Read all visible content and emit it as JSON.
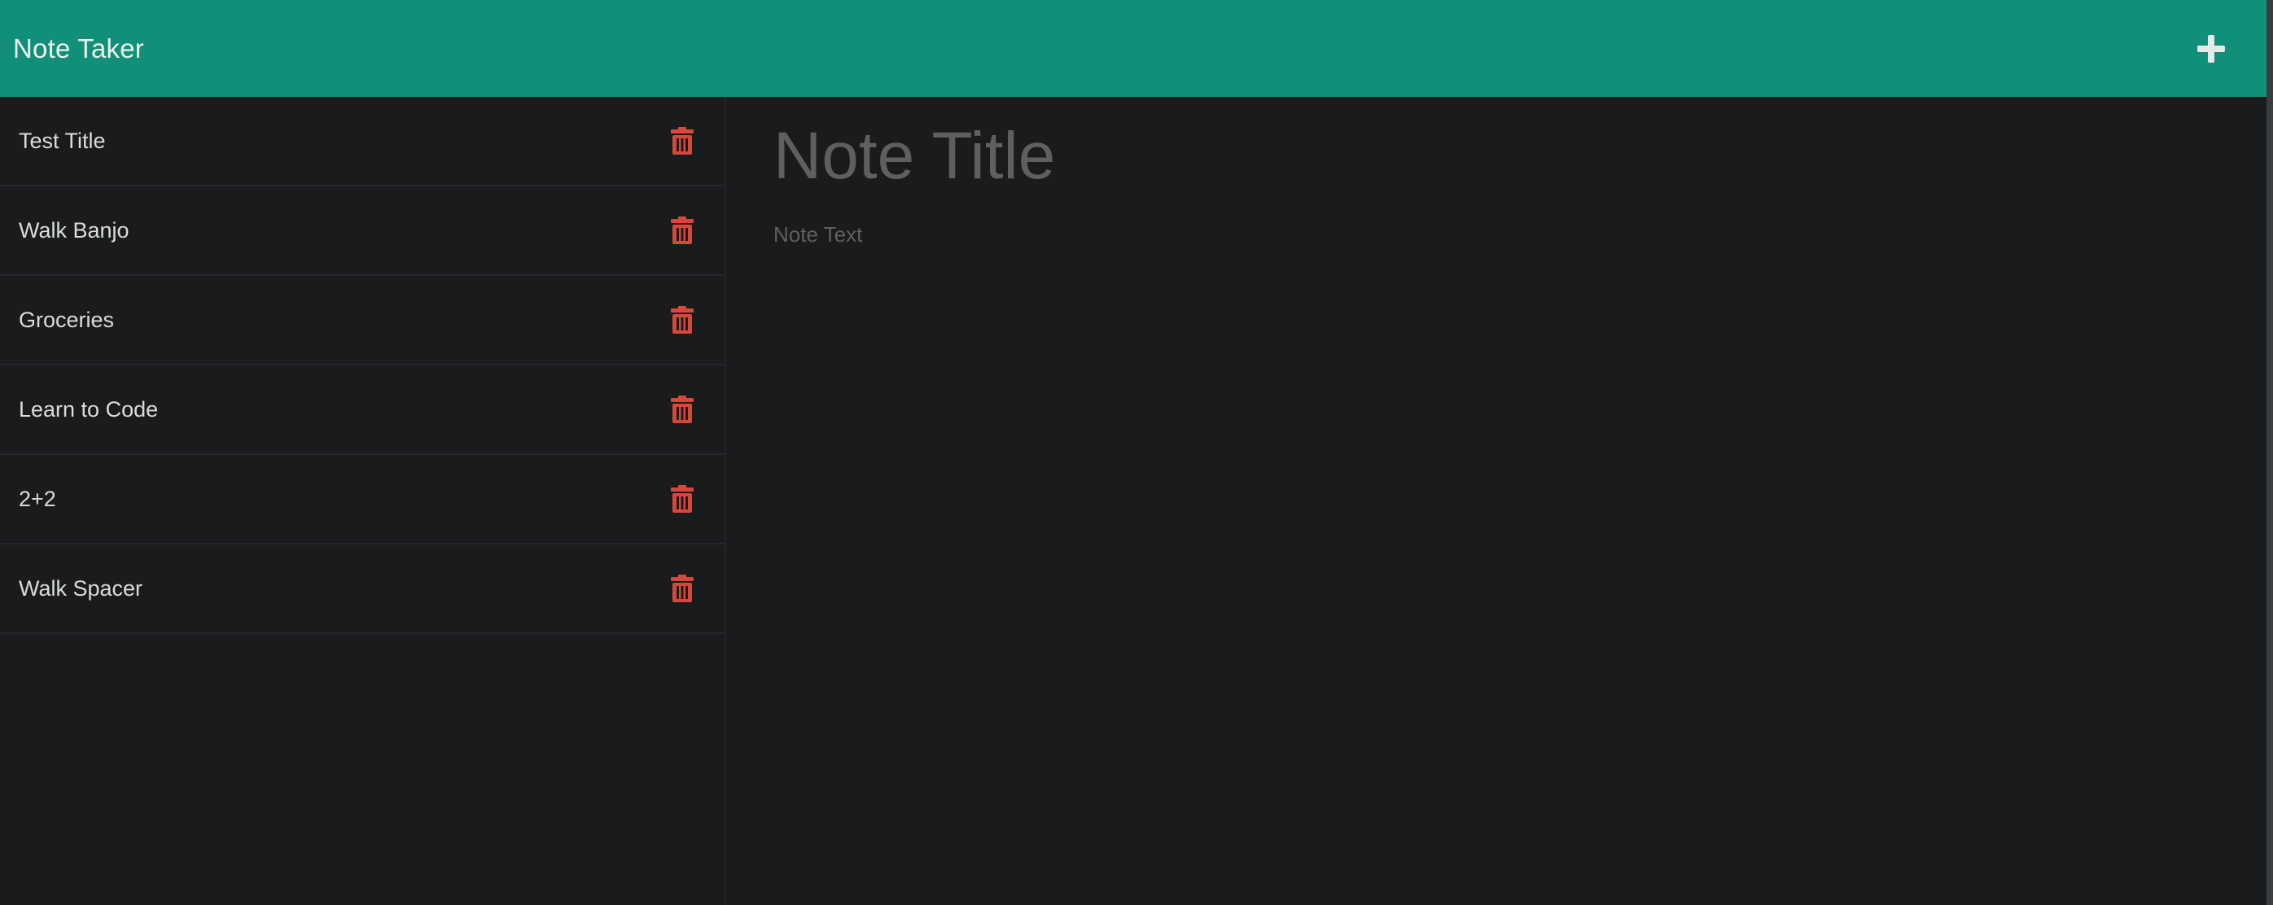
{
  "app": {
    "title": "Note Taker"
  },
  "header": {
    "new_note_icon": "plus-icon"
  },
  "notes": [
    {
      "title": "Test Title",
      "icon": "trash-icon"
    },
    {
      "title": "Walk Banjo",
      "icon": "trash-icon"
    },
    {
      "title": "Groceries",
      "icon": "trash-icon"
    },
    {
      "title": "Learn to Code",
      "icon": "trash-icon"
    },
    {
      "title": "2+2",
      "icon": "trash-icon"
    },
    {
      "title": "Walk Spacer",
      "icon": "trash-icon"
    }
  ],
  "editor": {
    "title_value": "",
    "title_placeholder": "Note Title",
    "text_value": "",
    "text_placeholder": "Note Text"
  },
  "colors": {
    "header_bg": "#128f78",
    "page_bg": "#1a1b1d",
    "delete_icon": "#d9473a",
    "placeholder": "#5e5f60"
  }
}
